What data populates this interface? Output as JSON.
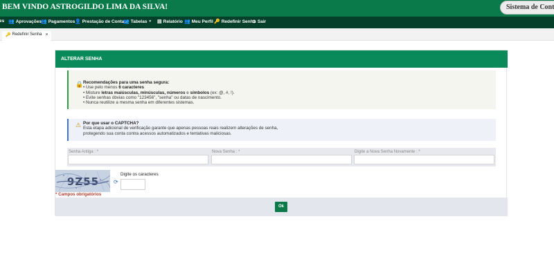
{
  "header": {
    "welcome": "BEM VINDO ASTROGILDO LIMA DA SILVA!",
    "system_button": "Sistema de Controle de",
    "brand_color": "#0a7a4a"
  },
  "nav": {
    "items": [
      {
        "label": "es",
        "icon": "none"
      },
      {
        "label": "Aprovações",
        "icon": "users-icon"
      },
      {
        "label": "Pagamentos",
        "icon": "users-icon"
      },
      {
        "label": "Prestação de Contas",
        "icon": "user-edit-icon"
      },
      {
        "label": "Tabelas",
        "icon": "users-icon"
      },
      {
        "label": "Relatório",
        "icon": "report-icon"
      },
      {
        "label": "Meu Perfil",
        "icon": "users-icon"
      },
      {
        "label": "Redefinir Senha",
        "icon": "key-icon"
      },
      {
        "label": "Sair",
        "icon": "logout-icon"
      }
    ]
  },
  "tabs": [
    {
      "label": "Redefinir Senha",
      "icon": "key-icon",
      "close": "×"
    }
  ],
  "card": {
    "title": "ALTERAR SENHA",
    "security_tips": {
      "icon": "lock-icon",
      "title": "Recomendações para uma senha segura:",
      "line1_prefix": "• Use pelo menos ",
      "line1_bold": "6 caracteres",
      "line2_prefix": "• Misture ",
      "line2_bold1": "letras maiúsculas, minúsculas, números",
      "line2_mid": " e ",
      "line2_bold2": "símbolos",
      "line2_suffix": " (ex: @, #, !).",
      "line3": "• Evite senhas óbvias como \"123456\", \"senha\" ou datas de nascimento.",
      "line4": "• Nunca reutilize a mesma senha em diferentes sistemas."
    },
    "captcha_info": {
      "icon": "warning-icon",
      "title": "Por que usar o CAPTCHA?",
      "line1": "Esta etapa adicional de verificação garante que apenas pessoas reais realizem alterações de senha,",
      "line2": "protegendo sua conta contra acessos automatizados e tentativas maliciosas."
    },
    "fields": [
      {
        "label": "Senha Antiga : *",
        "value": ""
      },
      {
        "label": "Nova Senha : *",
        "value": ""
      },
      {
        "label": "Digite a Nova Senha Novamente : *",
        "value": ""
      }
    ],
    "captcha": {
      "code": "9Z55",
      "label": "Digite os caracteres",
      "value": ""
    },
    "required_note": "* Campos obrigatórios",
    "ok_button": "Ok"
  }
}
